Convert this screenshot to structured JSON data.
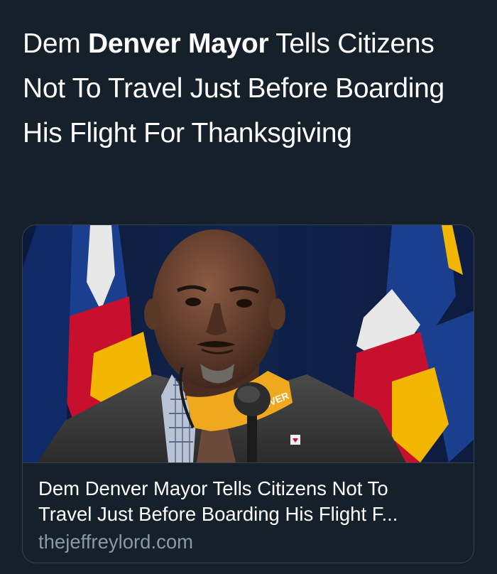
{
  "tweet": {
    "text_pre": "Dem ",
    "text_bold": "Denver Mayor",
    "text_post": " Tells Citizens Not To Travel Just Before Boarding His Flight For Thanksgiving"
  },
  "card": {
    "title_line1": "Dem Denver Mayor Tells Citizens Not To",
    "title_line2": "Travel Just Before Boarding His Flight F...",
    "domain": "thejeffreylord.com",
    "image_caption_on_mask": "NVER",
    "image_alt": "Denver Mayor speaking at a press conference"
  },
  "colors": {
    "background": "#15202b",
    "border": "#38444d",
    "secondary_text": "#8899a6",
    "mask": "#f0a81e",
    "flag_red": "#c8102e",
    "flag_blue": "#1a3f8f",
    "flag_gold": "#f2b600"
  }
}
